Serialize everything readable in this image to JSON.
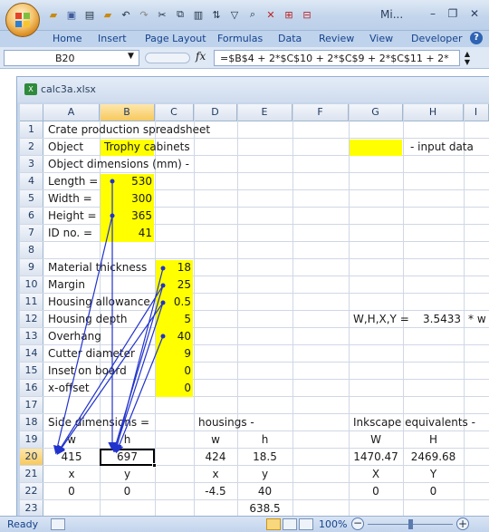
{
  "window": {
    "title": "Mi..."
  },
  "ribbon": {
    "tabs": [
      "Home",
      "Insert",
      "Page Layout",
      "Formulas",
      "Data",
      "Review",
      "View",
      "Developer"
    ]
  },
  "formula_bar": {
    "name_box": "B20",
    "fx": "fx",
    "formula": "=$B$4 + 2*$C$10 + 2*$C$9 + 2*$C$11 + 2*"
  },
  "workbook": {
    "filename": "calc3a.xlsx"
  },
  "columns": [
    "A",
    "B",
    "C",
    "D",
    "E",
    "F",
    "G",
    "H",
    "I"
  ],
  "rows": [
    "1",
    "2",
    "3",
    "4",
    "5",
    "6",
    "7",
    "8",
    "9",
    "10",
    "11",
    "12",
    "13",
    "14",
    "15",
    "16",
    "17",
    "18",
    "19",
    "20",
    "21",
    "22",
    "23"
  ],
  "cells": {
    "A1": "Crate  production spreadsheet",
    "A2": "Object",
    "B2": "Trophy cabinets",
    "H2": "- input data",
    "A3": "Object dimensions (mm) -",
    "A4": "Length =",
    "B4": "530",
    "A5": "Width =",
    "B5": "300",
    "A6": "Height =",
    "B6": "365",
    "A7": "ID no. =",
    "B7": "41",
    "A9": "Material thickness",
    "C9": "18",
    "A10": "Margin",
    "C10": "25",
    "A11": "Housing allowance",
    "C11": "0.5",
    "A12": "Housing depth",
    "C12": "5",
    "G12": "W,H,X,Y =",
    "H12": "3.5433",
    "I12": "* w",
    "A13": "Overhang",
    "C13": "40",
    "A14": "Cutter diameter",
    "C14": "9",
    "A15": "Inset on board",
    "C15": "0",
    "A16": "x-offset",
    "C16": "0",
    "A18": "Side dimensions =",
    "D18": "housings -",
    "G18": "Inkscape equivalents -",
    "A19": "w",
    "B19": "h",
    "D19": "w",
    "E19": "h",
    "G19": "W",
    "H19": "H",
    "A20": "415",
    "B20": "697",
    "D20": "424",
    "E20": "18.5",
    "G20": "1470.47",
    "H20": "2469.68",
    "A21": "x",
    "B21": "y",
    "D21": "x",
    "E21": "y",
    "G21": "X",
    "H21": "Y",
    "A22": "0",
    "B22": "0",
    "D22": "-4.5",
    "E22": "40",
    "G22": "0",
    "H22": "0",
    "E23": "638.5"
  },
  "status": {
    "ready": "Ready",
    "zoom": "100%"
  },
  "colors": {
    "input_fill": "#ffff00",
    "arrow": "#2233cc"
  }
}
